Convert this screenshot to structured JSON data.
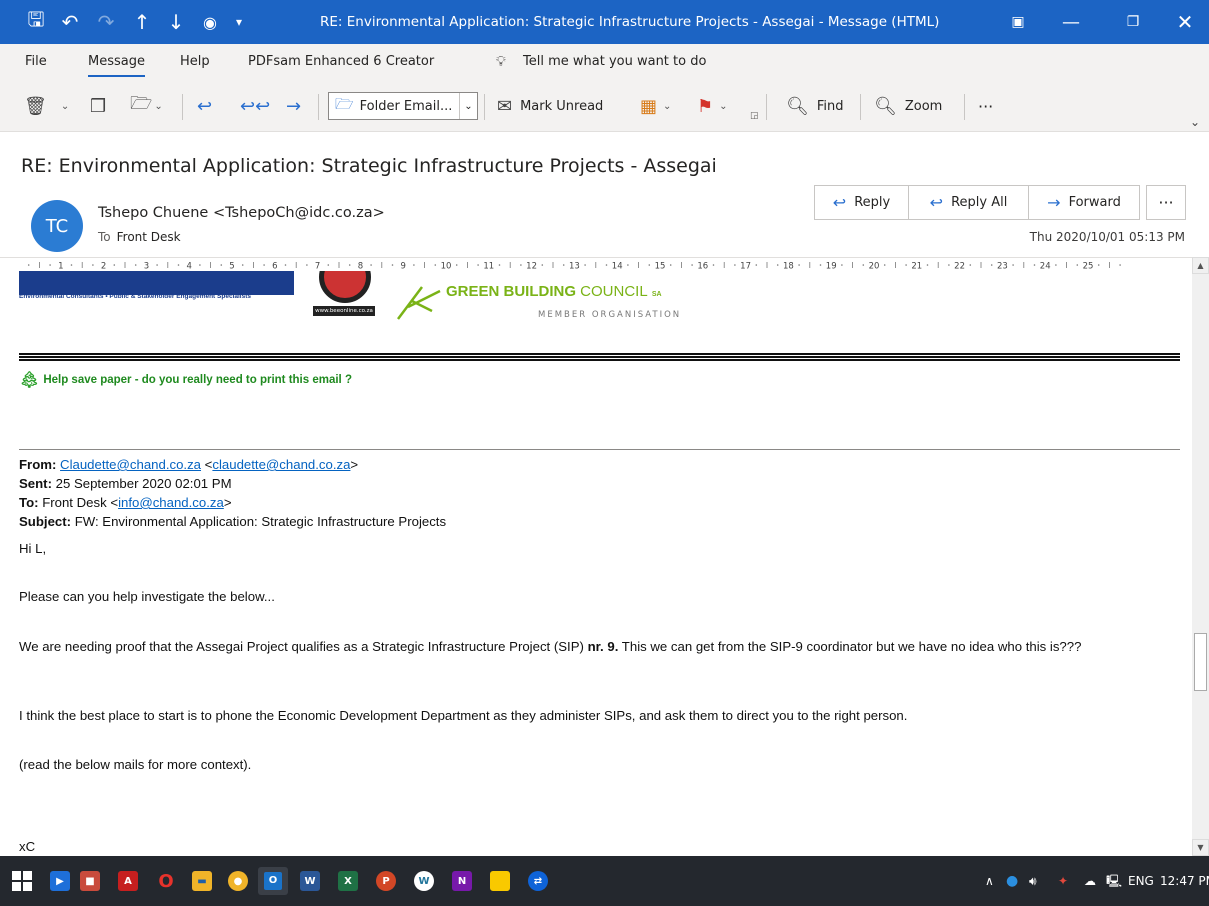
{
  "window": {
    "title": "RE: Environmental Application: Strategic Infrastructure Projects - Assegai  -  Message (HTML)",
    "accent": "#1c64c4"
  },
  "menu": {
    "tabs": [
      "File",
      "Message",
      "Help",
      "PDFsam Enhanced 6 Creator"
    ],
    "active": "Message",
    "tell_me": "Tell me what you want to do"
  },
  "toolbar": {
    "folder_combo": "Folder Email...",
    "mark_unread": "Mark Unread",
    "find": "Find",
    "zoom": "Zoom",
    "more": "···"
  },
  "message": {
    "subject": "RE: Environmental Application: Strategic Infrastructure Projects - Assegai",
    "avatar_initials": "TC",
    "avatar_color": "#2b7cd3",
    "sender": "Tshepo Chuene <TshepoCh@idc.co.za>",
    "to_label": "To",
    "to_value": "Front Desk",
    "date": "Thu 2020/10/01 05:13 PM",
    "actions": {
      "reply": "Reply",
      "reply_all": "Reply All",
      "forward": "Forward",
      "more": "···"
    }
  },
  "ruler": {
    "numbers": [
      "1",
      "2",
      "3",
      "4",
      "5",
      "6",
      "7",
      "8",
      "9",
      "10",
      "11",
      "12",
      "13",
      "14",
      "15",
      "16",
      "17",
      "18",
      "19",
      "20",
      "21",
      "22",
      "23",
      "24",
      "25"
    ]
  },
  "body": {
    "logos": {
      "chand_tagline": "Environmental Consultants • Public & Stakeholder Engagement Specialists",
      "bee_url": "www.beeonline.co.za",
      "gbc_bold": "GREEN BUILDING",
      "gbc_rest": " COUNCIL",
      "gbc_sa": "SA",
      "gbc_sub": "MEMBER ORGANISATION"
    },
    "save_paper": "Help save paper - do you really need to print this email  ?",
    "forwarded": {
      "from_label": "From:",
      "from_link": "Claudette@chand.co.za",
      "from_lt": " <",
      "from_link2": "claudette@chand.co.za",
      "from_gt": ">",
      "sent_label": "Sent:",
      "sent_value": " 25 September 2020 02:01 PM",
      "to_label": "To:",
      "to_value": " Front Desk <",
      "to_link": "info@chand.co.za",
      "to_gt": ">",
      "subject_label": "Subject:",
      "subject_value": " FW: Environmental Application: Strategic Infrastructure Projects"
    },
    "greeting": "Hi L,",
    "p1": "Please can you help investigate the below...",
    "p2_pre": "We are needing proof that the Assegai Project qualifies as a Strategic Infrastructure Project (SIP) ",
    "p2_bold": "nr. 9.",
    "p2_post": " This we can get from the SIP-9 coordinator but we have no idea who this is???",
    "p3": "I think the best place to start is to phone the Economic Development Department as they administer SIPs, and ask them to direct you to the right person.",
    "p4": "(read the below mails for more context).",
    "signoff": "xC"
  },
  "taskbar": {
    "lang": "ENG",
    "time": "12:47 PM"
  }
}
